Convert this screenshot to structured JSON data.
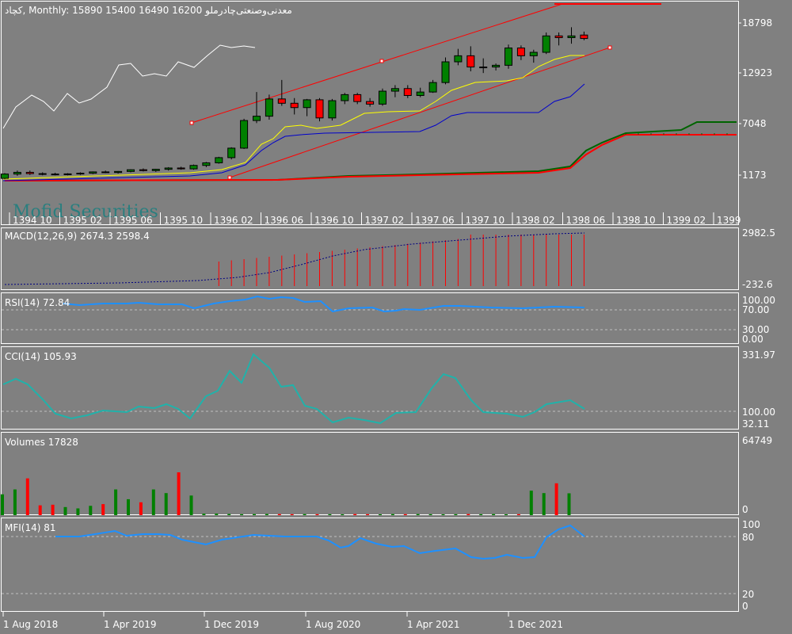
{
  "header": {
    "symbol": "کچاد",
    "timeframe": "Monthly",
    "ohlc": "15890 15400 16490 16200",
    "company": "معدنی‌وصنعتی‌چادرملو"
  },
  "watermark": "Mofid Securities",
  "colors": {
    "background": "#808080",
    "bull": "#008000",
    "bear": "#ff0000",
    "white": "#ffffff",
    "yellow": "#ffff00",
    "blue": "#0000cc",
    "rsi": "#1e90ff",
    "cci": "#20b2aa",
    "macd_signal": "#000080",
    "cloud_a": "#006400",
    "cloud_b": "#ff0000"
  },
  "price_axis": [
    "18798",
    "12923",
    "7048",
    "1173"
  ],
  "upper_time_labels": [
    "1394 10",
    "1395 02",
    "1395 06",
    "1395 10",
    "1396 02",
    "1396 06",
    "1396 10",
    "1397 02",
    "1397 06",
    "1397 10",
    "1398 02",
    "1398 06",
    "1398 10",
    "1399 02",
    "1399"
  ],
  "bottom_time_labels": [
    "1 Aug 2018",
    "1 Apr 2019",
    "1 Dec 2019",
    "1 Aug 2020",
    "1 Apr 2021",
    "1 Dec 2021"
  ],
  "indicators": {
    "macd": {
      "label": "MACD(12,26,9) 2674.3 2598.4",
      "axis": [
        "2982.5",
        "-232.6"
      ]
    },
    "rsi": {
      "label": "RSI(14) 72.84",
      "axis": [
        "100.00",
        "70.00",
        "30.00",
        "0.00"
      ]
    },
    "cci": {
      "label": "CCI(14) 105.93",
      "axis": [
        "331.97",
        "100.00",
        "32.11"
      ]
    },
    "volumes": {
      "label": "Volumes 17828",
      "axis": [
        "64749",
        "0"
      ]
    },
    "mfi": {
      "label": "MFI(14) 81",
      "axis": [
        "100",
        "80",
        "20",
        "0"
      ]
    }
  },
  "chart_data": {
    "type": "candlestick",
    "candles": [
      {
        "o": 800,
        "h": 1400,
        "l": 700,
        "c": 1300
      },
      {
        "o": 1300,
        "h": 1700,
        "l": 1100,
        "c": 1500
      },
      {
        "o": 1500,
        "h": 1700,
        "l": 1200,
        "c": 1350
      },
      {
        "o": 1350,
        "h": 1500,
        "l": 1150,
        "c": 1300
      },
      {
        "o": 1300,
        "h": 1450,
        "l": 1150,
        "c": 1250
      },
      {
        "o": 1250,
        "h": 1400,
        "l": 1150,
        "c": 1320
      },
      {
        "o": 1320,
        "h": 1500,
        "l": 1200,
        "c": 1400
      },
      {
        "o": 1400,
        "h": 1600,
        "l": 1300,
        "c": 1550
      },
      {
        "o": 1550,
        "h": 1700,
        "l": 1400,
        "c": 1480
      },
      {
        "o": 1480,
        "h": 1650,
        "l": 1350,
        "c": 1600
      },
      {
        "o": 1600,
        "h": 1850,
        "l": 1500,
        "c": 1800
      },
      {
        "o": 1800,
        "h": 1950,
        "l": 1600,
        "c": 1700
      },
      {
        "o": 1700,
        "h": 1900,
        "l": 1550,
        "c": 1850
      },
      {
        "o": 1850,
        "h": 2100,
        "l": 1700,
        "c": 2000
      },
      {
        "o": 2000,
        "h": 2150,
        "l": 1800,
        "c": 1900
      },
      {
        "o": 1900,
        "h": 2400,
        "l": 1800,
        "c": 2300
      },
      {
        "o": 2300,
        "h": 2700,
        "l": 2100,
        "c": 2600
      },
      {
        "o": 2600,
        "h": 3300,
        "l": 2500,
        "c": 3200
      },
      {
        "o": 3200,
        "h": 4400,
        "l": 3000,
        "c": 4300
      },
      {
        "o": 4300,
        "h": 7700,
        "l": 4200,
        "c": 7500
      },
      {
        "o": 7500,
        "h": 10800,
        "l": 7200,
        "c": 8000
      },
      {
        "o": 8000,
        "h": 10500,
        "l": 7600,
        "c": 10000
      },
      {
        "o": 10000,
        "h": 12200,
        "l": 9200,
        "c": 9500
      },
      {
        "o": 9500,
        "h": 10100,
        "l": 8200,
        "c": 9000
      },
      {
        "o": 9000,
        "h": 10000,
        "l": 8000,
        "c": 9900
      },
      {
        "o": 9900,
        "h": 10100,
        "l": 7400,
        "c": 7800
      },
      {
        "o": 7800,
        "h": 10000,
        "l": 7500,
        "c": 9800
      },
      {
        "o": 9800,
        "h": 10700,
        "l": 9400,
        "c": 10500
      },
      {
        "o": 10500,
        "h": 10700,
        "l": 9400,
        "c": 9700
      },
      {
        "o": 9700,
        "h": 10100,
        "l": 9100,
        "c": 9400
      },
      {
        "o": 9400,
        "h": 11200,
        "l": 9200,
        "c": 10900
      },
      {
        "o": 10900,
        "h": 11600,
        "l": 10200,
        "c": 11200
      },
      {
        "o": 11200,
        "h": 11600,
        "l": 10100,
        "c": 10400
      },
      {
        "o": 10400,
        "h": 11300,
        "l": 10200,
        "c": 10800
      },
      {
        "o": 10800,
        "h": 12200,
        "l": 10700,
        "c": 11900
      },
      {
        "o": 11900,
        "h": 14800,
        "l": 11700,
        "c": 14300
      },
      {
        "o": 14300,
        "h": 15800,
        "l": 13900,
        "c": 15000
      },
      {
        "o": 15000,
        "h": 16100,
        "l": 13200,
        "c": 13700
      },
      {
        "o": 13700,
        "h": 14700,
        "l": 13000,
        "c": 13700
      },
      {
        "o": 13700,
        "h": 14100,
        "l": 13300,
        "c": 13900
      },
      {
        "o": 13900,
        "h": 16300,
        "l": 13500,
        "c": 15900
      },
      {
        "o": 15900,
        "h": 16200,
        "l": 14500,
        "c": 15000
      },
      {
        "o": 15000,
        "h": 15700,
        "l": 14200,
        "c": 15400
      },
      {
        "o": 15400,
        "h": 17700,
        "l": 15200,
        "c": 17300
      },
      {
        "o": 17300,
        "h": 17700,
        "l": 16200,
        "c": 17100
      },
      {
        "o": 17100,
        "h": 18300,
        "l": 16400,
        "c": 17300
      },
      {
        "o": 17400,
        "h": 17800,
        "l": 16800,
        "c": 17000
      }
    ],
    "volumes": [
      17000,
      21000,
      30000,
      8000,
      8500,
      6600,
      5500,
      7600,
      9000,
      21000,
      13000,
      10500,
      21000,
      18000,
      35000,
      16000,
      1200,
      1300,
      1000,
      800,
      900,
      1000,
      900,
      800,
      900,
      800,
      800,
      700,
      900,
      800,
      700,
      900,
      800,
      900,
      800,
      700,
      800,
      900,
      800,
      900,
      700,
      800,
      20000,
      18000,
      26000,
      17828
    ]
  }
}
